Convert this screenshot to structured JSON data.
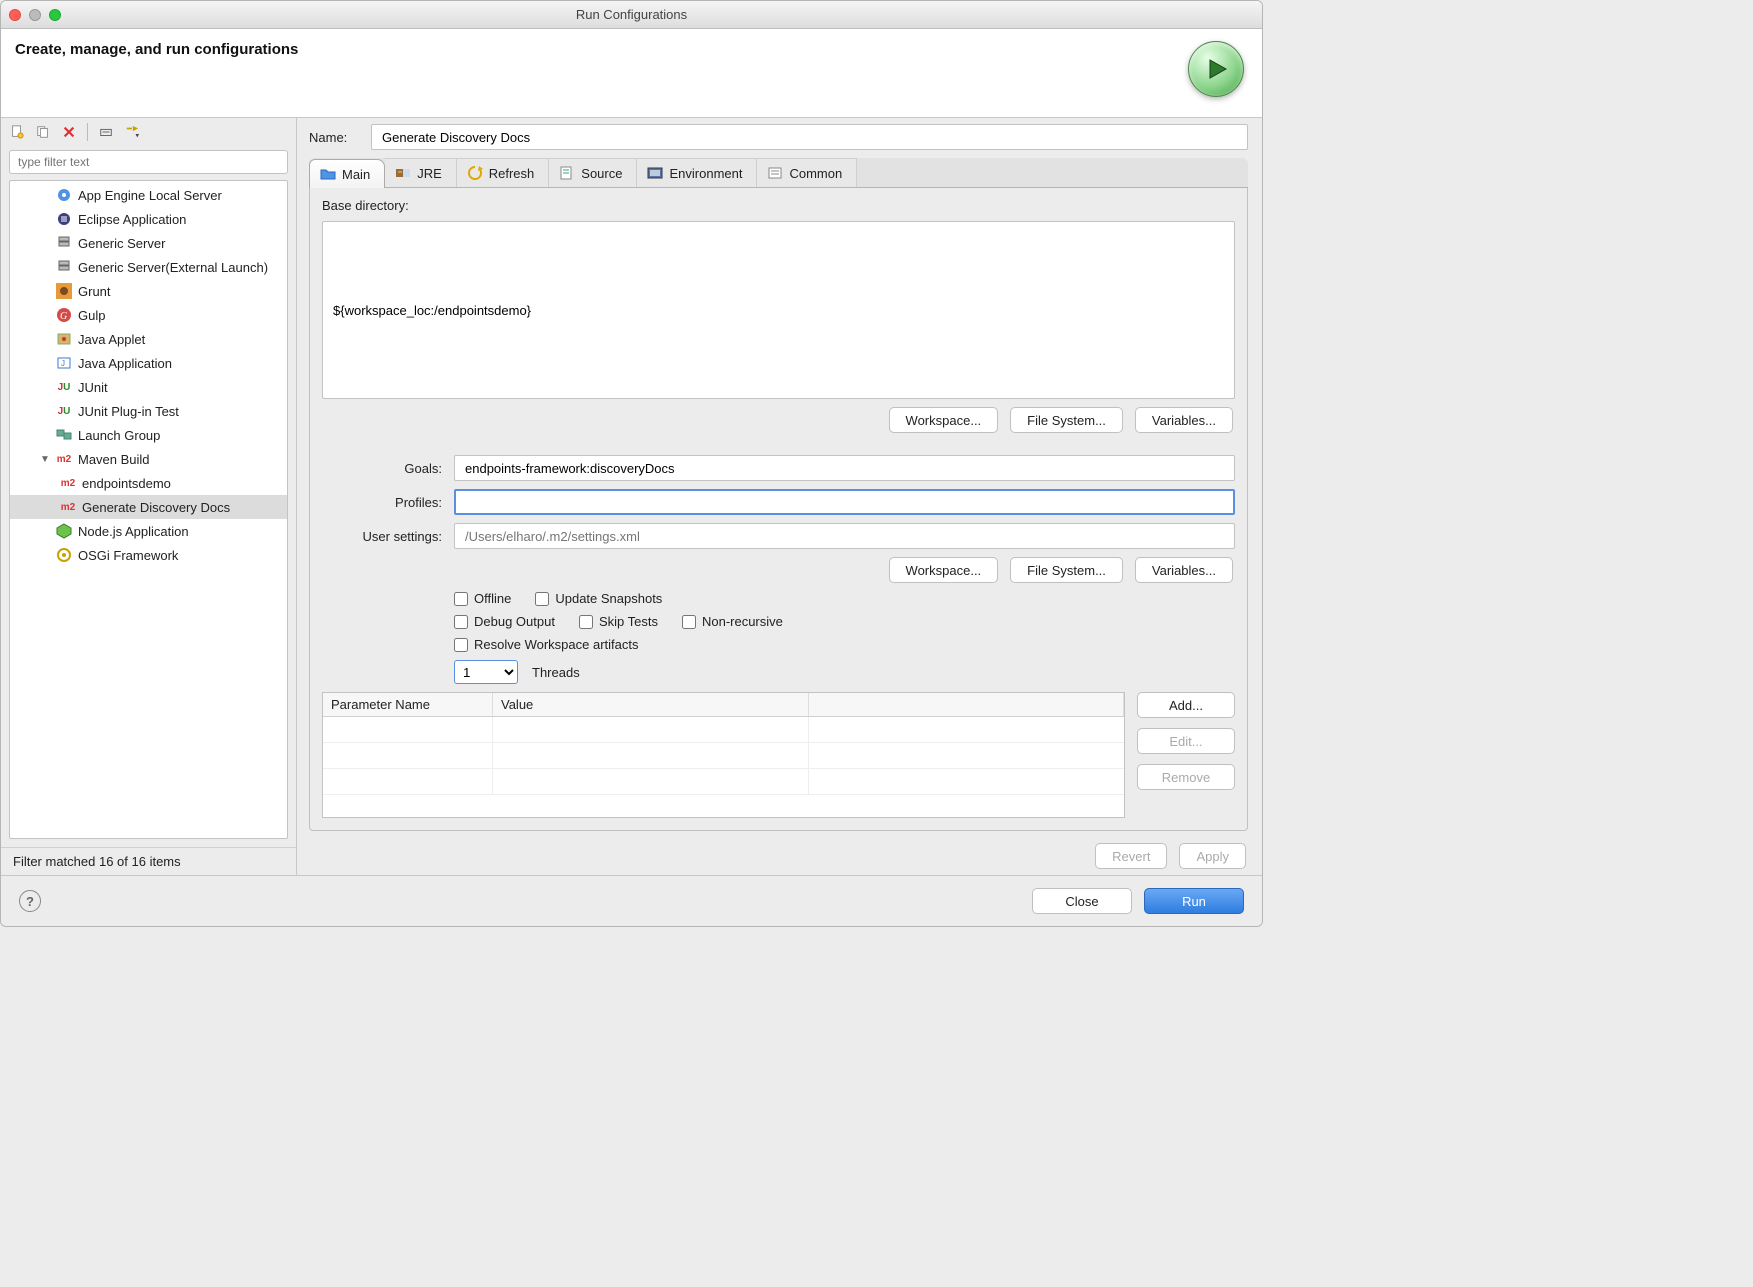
{
  "window": {
    "title": "Run Configurations"
  },
  "header": {
    "heading": "Create, manage, and run configurations"
  },
  "toolbar": {
    "new": "New",
    "duplicate": "Duplicate",
    "delete": "Delete",
    "collapse": "Collapse All",
    "filter_menu": "Filter"
  },
  "filter": {
    "placeholder": "type filter text"
  },
  "tree": [
    {
      "label": "App Engine Local Server",
      "icon": "appengine"
    },
    {
      "label": "Eclipse Application",
      "icon": "eclipse"
    },
    {
      "label": "Generic Server",
      "icon": "server"
    },
    {
      "label": "Generic Server(External Launch)",
      "icon": "server"
    },
    {
      "label": "Grunt",
      "icon": "grunt"
    },
    {
      "label": "Gulp",
      "icon": "gulp"
    },
    {
      "label": "Java Applet",
      "icon": "applet"
    },
    {
      "label": "Java Application",
      "icon": "javaapp"
    },
    {
      "label": "JUnit",
      "icon": "junit"
    },
    {
      "label": "JUnit Plug-in Test",
      "icon": "junit"
    },
    {
      "label": "Launch Group",
      "icon": "launchgroup"
    },
    {
      "label": "Maven Build",
      "icon": "m2",
      "expanded": true,
      "children": [
        {
          "label": "endpointsdemo",
          "icon": "m2"
        },
        {
          "label": "Generate Discovery Docs",
          "icon": "m2",
          "selected": true
        }
      ]
    },
    {
      "label": "Node.js Application",
      "icon": "node"
    },
    {
      "label": "OSGi Framework",
      "icon": "osgi"
    }
  ],
  "status": {
    "text": "Filter matched 16 of 16 items"
  },
  "name": {
    "label": "Name:",
    "value": "Generate Discovery Docs"
  },
  "tabs": {
    "main": "Main",
    "jre": "JRE",
    "refresh": "Refresh",
    "source": "Source",
    "environment": "Environment",
    "common": "Common"
  },
  "main": {
    "base_label": "Base directory:",
    "base_value": "${workspace_loc:/endpointsdemo}",
    "workspace_btn": "Workspace...",
    "filesystem_btn": "File System...",
    "variables_btn": "Variables...",
    "goals_label": "Goals:",
    "goals_value": "endpoints-framework:discoveryDocs",
    "profiles_label": "Profiles:",
    "profiles_value": "",
    "user_settings_label": "User settings:",
    "user_settings_placeholder": "/Users/elharo/.m2/settings.xml",
    "checks": {
      "offline": "Offline",
      "update_snapshots": "Update Snapshots",
      "debug_output": "Debug Output",
      "skip_tests": "Skip Tests",
      "non_recursive": "Non-recursive",
      "resolve_workspace": "Resolve Workspace artifacts"
    },
    "threads": {
      "value": "1",
      "label": "Threads"
    },
    "params": {
      "col_name": "Parameter Name",
      "col_value": "Value",
      "add": "Add...",
      "edit": "Edit...",
      "remove": "Remove"
    }
  },
  "bottom": {
    "revert": "Revert",
    "apply": "Apply"
  },
  "footer": {
    "close": "Close",
    "run": "Run"
  }
}
